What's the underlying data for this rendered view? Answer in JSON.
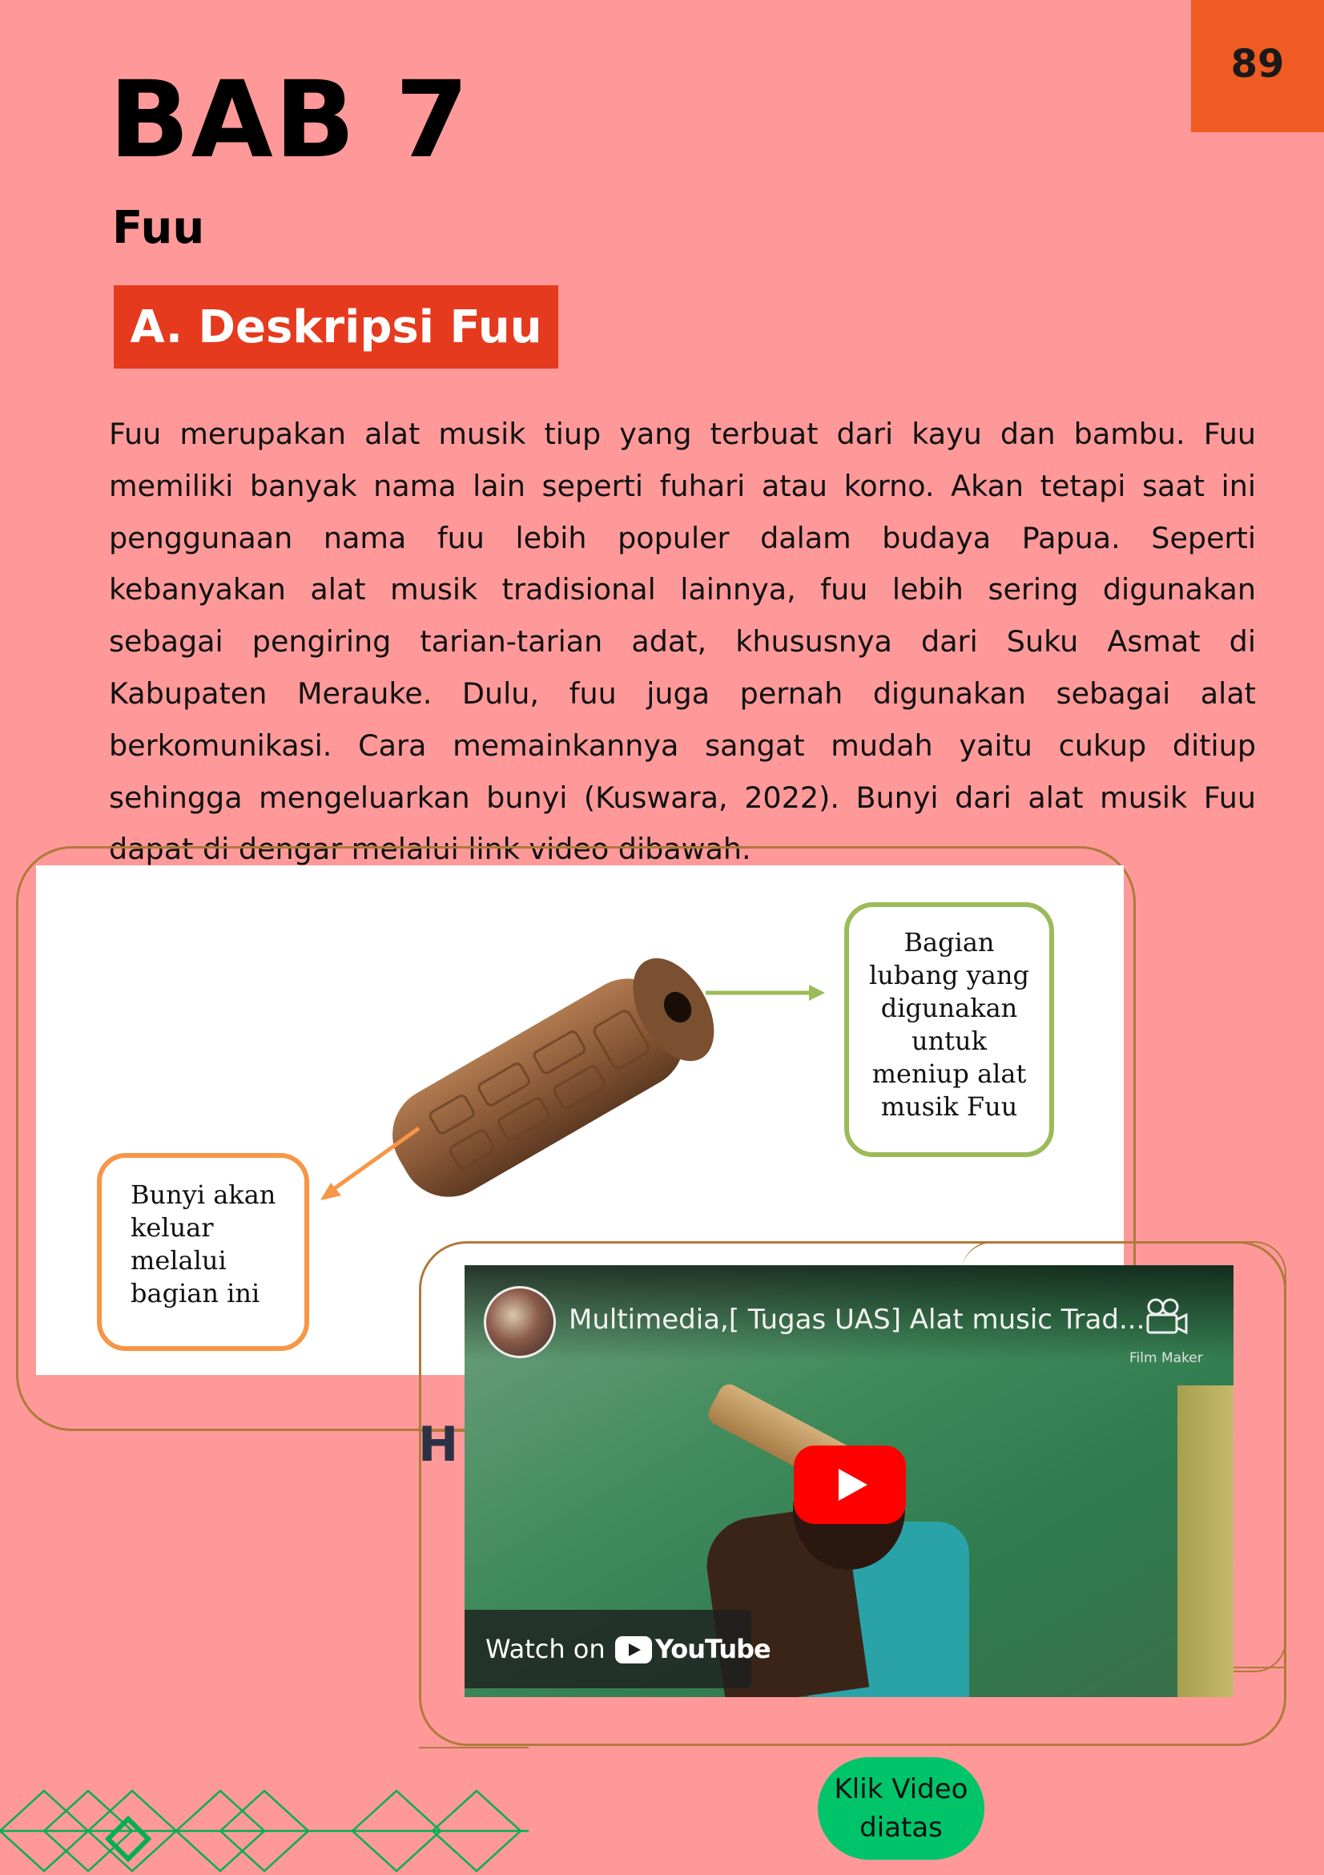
{
  "page": {
    "number": "89"
  },
  "header": {
    "chapter": "BAB 7",
    "subtitle": "Fuu",
    "section": "A. Deskripsi Fuu"
  },
  "body": {
    "paragraph": "Fuu merupakan alat musik tiup yang terbuat dari kayu dan bambu. Fuu memiliki banyak nama lain seperti fuhari atau korno. Akan tetapi saat ini penggunaan nama fuu lebih populer dalam budaya Papua. Seperti kebanyakan alat musik tradisional lainnya, fuu lebih sering digunakan sebagai pengiring tarian-tarian adat, khususnya dari Suku Asmat di Kabupaten Merauke. Dulu, fuu juga pernah digunakan sebagai alat berkomunikasi. Cara memainkannya sangat mudah yaitu cukup ditiup sehingga mengeluarkan bunyi (Kuswara, 2022). Bunyi dari alat musik Fuu dapat di dengar melalui link video dibawah."
  },
  "figure": {
    "callout_top": [
      "Bagian",
      "lubang yang",
      "digunakan",
      "untuk",
      "meniup alat",
      "musik Fuu"
    ],
    "callout_bottom": [
      "Bunyi akan",
      "keluar",
      "melalui",
      "bagian ini"
    ]
  },
  "decor": {
    "h_mark": "H"
  },
  "video": {
    "title": "Multimedia,[ Tugas UAS] Alat music Trad...",
    "channel_badge": "Film Maker",
    "watch_on": "Watch on",
    "platform": "YouTube",
    "icons": [
      "channel-avatar",
      "camera-icon",
      "play-icon",
      "youtube-icon"
    ]
  },
  "cta": {
    "line1": "Klik Video",
    "line2": "diatas"
  },
  "colors": {
    "background": "#ff9999",
    "page_number_box": "#ef5b22",
    "section_box": "#e63a1e",
    "frame": "#b07a3c",
    "callout_green": "#9bbb59",
    "callout_orange": "#f79646",
    "cta": "#00c46a",
    "pattern": "#00b050"
  }
}
